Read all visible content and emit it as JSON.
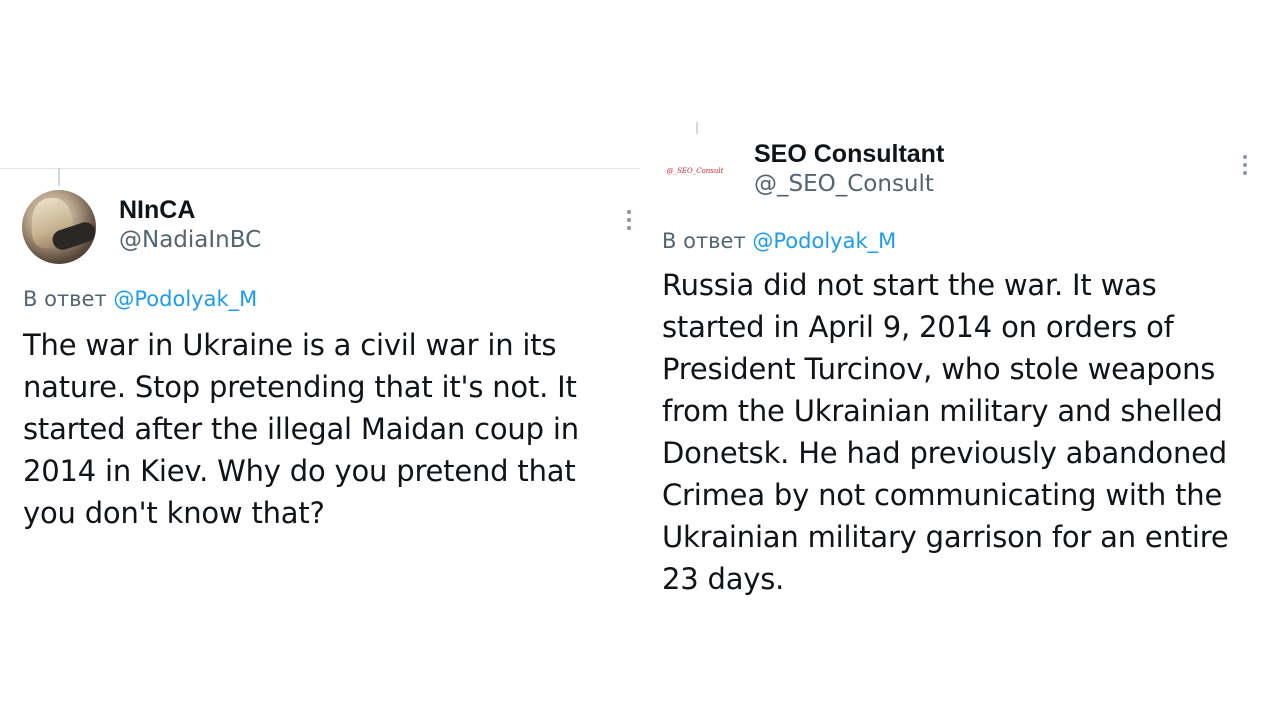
{
  "left_tweet": {
    "author_name": "NInCA",
    "author_handle": "@NadiaInBC",
    "reply_prefix": "В ответ ",
    "reply_to": "@Podolyak_M",
    "body": "The war in Ukraine is a civil war in its\nnature. Stop pretending that it's not. It\nstarted after the illegal Maidan coup in\n2014 in Kiev. Why do you pretend that\nyou don't know that?",
    "more_icon": "more-vertical-icon"
  },
  "right_tweet": {
    "author_name": "SEO Consultant",
    "author_handle": "@_SEO_Consult",
    "avatar_text": "@_SEO_Consult",
    "reply_prefix": "В ответ ",
    "reply_to": "@Podolyak_M",
    "body": "Russia did not start the war. It was\nstarted in April 9, 2014 on orders of\nPresident Turcinov, who stole weapons\nfrom the Ukrainian military and shelled\nDonetsk. He had previously abandoned\nCrimea by not communicating with the\nUkrainian military garrison for an entire\n23 days.",
    "more_icon": "more-vertical-icon"
  },
  "colors": {
    "text_primary": "#0f1419",
    "text_secondary": "#536471",
    "link": "#1d9bf0",
    "avatar_logo": "#c0282d"
  }
}
